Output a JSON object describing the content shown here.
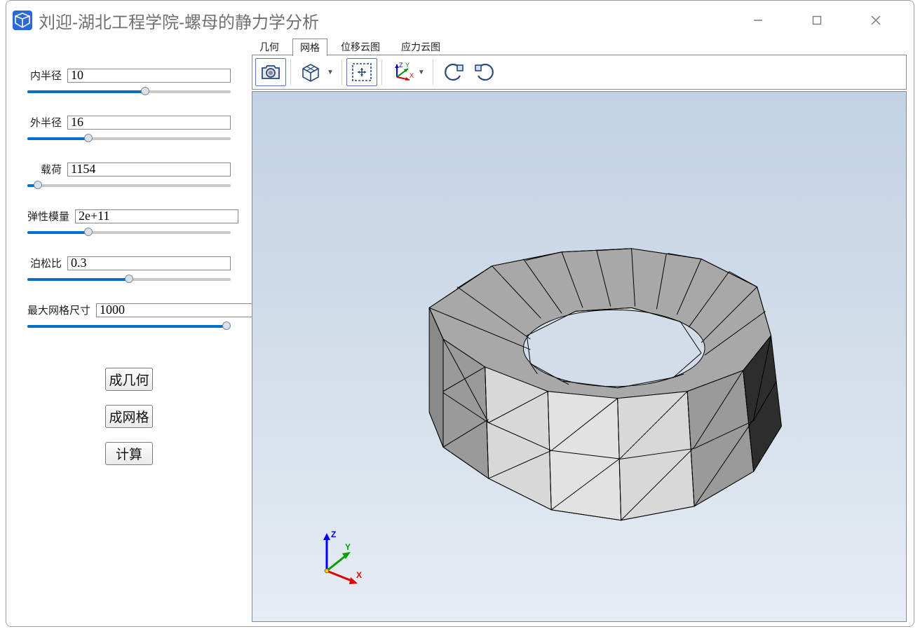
{
  "window": {
    "title": "刘迎-湖北工程学院-螺母的静力学分析"
  },
  "sidebar": {
    "params": [
      {
        "label": "内半径",
        "value": "10",
        "slider_percent": 58,
        "label_w": "w1"
      },
      {
        "label": "外半径",
        "value": "16",
        "slider_percent": 30,
        "label_w": "w1"
      },
      {
        "label": "载荷",
        "value": "1154",
        "slider_percent": 5,
        "label_w": "w1"
      },
      {
        "label": "弹性模量",
        "value": "2e+11",
        "slider_percent": 30,
        "label_w": "w2"
      },
      {
        "label": "泊松比",
        "value": "0.3",
        "slider_percent": 50,
        "label_w": "w1"
      },
      {
        "label": "最大网格尺寸",
        "value": "1000",
        "slider_percent": 98,
        "label_w": "w3"
      }
    ],
    "buttons": [
      {
        "label": "成几何"
      },
      {
        "label": "成网格"
      },
      {
        "label": "计算"
      }
    ]
  },
  "tabs": [
    {
      "label": "几何",
      "active": false
    },
    {
      "label": "网格",
      "active": true
    },
    {
      "label": "位移云图",
      "active": false
    },
    {
      "label": "应力云图",
      "active": false
    }
  ],
  "toolbar": {
    "screenshot": "screenshot-icon",
    "viewcube": "viewcube-icon",
    "fit": "fit-icon",
    "axes": "axes-icon",
    "rotate_ccw": "rotate-ccw-icon",
    "rotate_cw": "rotate-cw-icon"
  },
  "triad_labels": {
    "x": "X",
    "y": "Y",
    "z": "Z"
  }
}
